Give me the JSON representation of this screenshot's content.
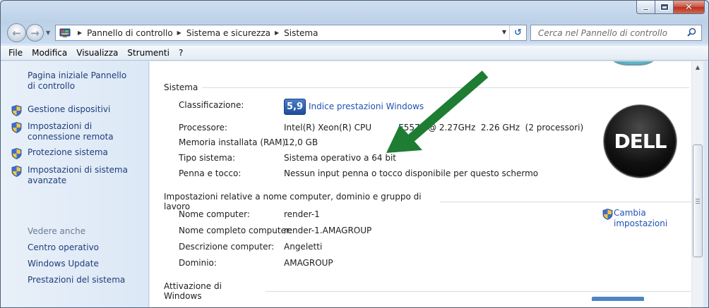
{
  "window": {
    "minimize_glyph": "",
    "close_glyph": "✕"
  },
  "address": {
    "crumbs": [
      "Pannello di controllo",
      "Sistema e sicurezza",
      "Sistema"
    ]
  },
  "search": {
    "placeholder": "Cerca nel Pannello di controllo"
  },
  "menu": {
    "file": "File",
    "edit": "Modifica",
    "view": "Visualizza",
    "tools": "Strumenti",
    "help": "?"
  },
  "sidebar": {
    "home": "Pagina iniziale Pannello di controllo",
    "items": [
      "Gestione dispositivi",
      "Impostazioni di connessione remota",
      "Protezione sistema",
      "Impostazioni di sistema avanzate"
    ],
    "see_also": "Vedere anche",
    "see_also_links": [
      "Centro operativo",
      "Windows Update",
      "Prestazioni del sistema"
    ]
  },
  "system": {
    "heading": "Sistema",
    "rating_label": "Classificazione:",
    "rating_score": "5,9",
    "rating_link": "Indice prestazioni Windows",
    "processor_label": "Processore:",
    "processor_value": "Intel(R) Xeon(R) CPU          E557   @ 2.27GHz  2.26 GHz  (2 processori)",
    "memory_label": "Memoria installata (RAM):",
    "memory_value": "12,0 GB",
    "type_label": "Tipo sistema:",
    "type_value": "Sistema operativo a 64 bit",
    "pen_label": "Penna e tocco:",
    "pen_value": "Nessun input penna o tocco disponibile per questo schermo"
  },
  "computer": {
    "heading": "Impostazioni relative a nome computer, dominio e gruppo di lavoro",
    "name_label": "Nome computer:",
    "name_value": "render-1",
    "fullname_label": "Nome completo computer:",
    "fullname_value": "render-1.AMAGROUP",
    "desc_label": "Descrizione computer:",
    "desc_value": "Angeletti",
    "domain_label": "Dominio:",
    "domain_value": "AMAGROUP",
    "change_link": "Cambia impostazioni"
  },
  "activation": {
    "heading": "Attivazione di Windows"
  },
  "logo": {
    "text": "DELL"
  },
  "colors": {
    "arrow": "#1e7d32",
    "link": "#1f52b3"
  }
}
